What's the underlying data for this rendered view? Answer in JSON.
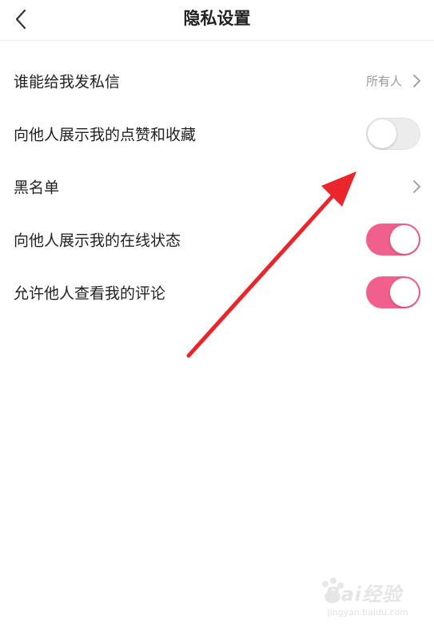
{
  "header": {
    "title": "隐私设置",
    "back_icon": "chevron-left-icon"
  },
  "rows": [
    {
      "label": "谁能给我发私信",
      "value": "所有人",
      "type": "link"
    },
    {
      "label": "向他人展示我的点赞和收藏",
      "type": "toggle",
      "enabled": false
    },
    {
      "label": "黑名单",
      "type": "link"
    },
    {
      "label": "向他人展示我的在线状态",
      "type": "toggle",
      "enabled": true
    },
    {
      "label": "允许他人查看我的评论",
      "type": "toggle",
      "enabled": true
    }
  ],
  "colors": {
    "toggle_on": "#f0608a",
    "toggle_off": "#ececec",
    "annotation_arrow": "#e8262b",
    "secondary_text": "#999999"
  },
  "watermark": {
    "brand": "Bai经验",
    "domain": "jingyan.baidu.com"
  }
}
